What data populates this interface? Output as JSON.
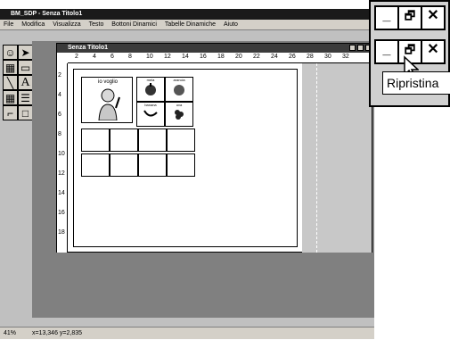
{
  "window": {
    "title": "BM_SDP - Senza Titolo1",
    "menu": [
      "File",
      "Modifica",
      "Visualizza",
      "Testo",
      "Bottoni Dinamici",
      "Tabelle Dinamiche",
      "Aiuto"
    ]
  },
  "document": {
    "title": "Senza Titolo1",
    "ruler_top": [
      "2",
      "4",
      "6",
      "8",
      "10",
      "12",
      "14",
      "16",
      "18",
      "20",
      "22",
      "24",
      "26",
      "28",
      "30",
      "32"
    ],
    "ruler_left": [
      "2",
      "4",
      "6",
      "8",
      "10",
      "12",
      "14",
      "16",
      "18"
    ],
    "main_cell_label": "io voglio",
    "mini_labels": [
      "mela",
      "arancia",
      "banana",
      "uva"
    ]
  },
  "toolbox": {
    "text_tool": "A"
  },
  "status": {
    "zoom": "41%",
    "coords": "x=13,346  y=2,835"
  },
  "zoom_overlay": {
    "min_glyph": "_",
    "restore_glyph": "🗗",
    "close_glyph": "✕",
    "tooltip": "Ripristina"
  }
}
